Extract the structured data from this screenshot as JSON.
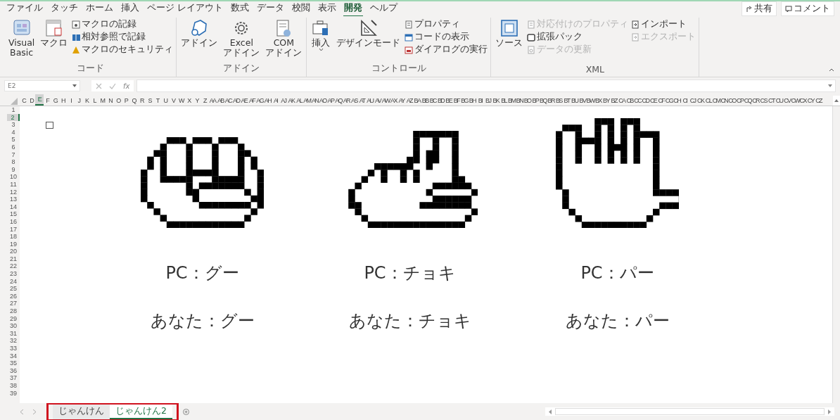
{
  "ribbon_tabs": [
    {
      "label": "ファイル",
      "selected": false
    },
    {
      "label": "タッチ",
      "selected": false
    },
    {
      "label": "ホーム",
      "selected": false
    },
    {
      "label": "挿入",
      "selected": false
    },
    {
      "label": "ページ レイアウト",
      "selected": false
    },
    {
      "label": "数式",
      "selected": false
    },
    {
      "label": "データ",
      "selected": false
    },
    {
      "label": "校閲",
      "selected": false
    },
    {
      "label": "表示",
      "selected": false
    },
    {
      "label": "開発",
      "selected": true
    },
    {
      "label": "ヘルプ",
      "selected": false
    }
  ],
  "header_buttons": [
    {
      "label": "共有",
      "kind": "share"
    },
    {
      "label": "コメント",
      "kind": "comment"
    }
  ],
  "ribbon_groups": [
    {
      "name": "コード",
      "items": [
        {
          "kind": "large",
          "label": "Visual Basic"
        },
        {
          "kind": "large",
          "label": "マクロ"
        },
        {
          "kind": "stack",
          "items": [
            {
              "label": "マクロの記録",
              "disabled": false
            },
            {
              "label": "相対参照で記録",
              "disabled": false
            },
            {
              "label": "マクロのセキュリティ",
              "disabled": false
            }
          ]
        }
      ]
    },
    {
      "name": "アドイン",
      "items": [
        {
          "kind": "large",
          "label": "アドイン"
        },
        {
          "kind": "large",
          "label": "Excel アドイン"
        },
        {
          "kind": "large",
          "label": "COM アドイン"
        }
      ]
    },
    {
      "name": "コントロール",
      "items": [
        {
          "kind": "dropdown",
          "label": "挿入"
        },
        {
          "kind": "large",
          "label": "デザインモード"
        },
        {
          "kind": "stack",
          "items": [
            {
              "label": "プロパティ",
              "disabled": false
            },
            {
              "label": "コードの表示",
              "disabled": false
            },
            {
              "label": "ダイアログの実行",
              "disabled": false
            }
          ]
        }
      ]
    },
    {
      "name": "XML",
      "items": [
        {
          "kind": "large",
          "label": "ソース"
        },
        {
          "kind": "stack",
          "items": [
            {
              "label": "対応付けのプロパティ",
              "disabled": true
            },
            {
              "label": "拡張パック",
              "disabled": false
            },
            {
              "label": "データの更新",
              "disabled": true
            }
          ]
        },
        {
          "kind": "stack",
          "items": [
            {
              "label": "インポート",
              "disabled": false
            },
            {
              "label": "エクスポート",
              "disabled": true
            }
          ]
        }
      ]
    }
  ],
  "formula_bar": {
    "name_box": "E2",
    "function_label": "fx"
  },
  "columns": [
    {
      "label": "C",
      "selected": false
    },
    {
      "label": "D",
      "selected": false
    },
    {
      "label": "E",
      "selected": true
    },
    {
      "label": "F",
      "selected": false
    },
    {
      "label": "G",
      "selected": false
    },
    {
      "label": "H",
      "selected": false
    },
    {
      "label": "I",
      "selected": false
    },
    {
      "label": "J",
      "selected": false
    },
    {
      "label": "K",
      "selected": false
    },
    {
      "label": "L",
      "selected": false
    },
    {
      "label": "M",
      "selected": false
    },
    {
      "label": "N",
      "selected": false
    },
    {
      "label": "O",
      "selected": false
    },
    {
      "label": "P",
      "selected": false
    },
    {
      "label": "Q",
      "selected": false
    },
    {
      "label": "R",
      "selected": false
    },
    {
      "label": "S",
      "selected": false
    },
    {
      "label": "T",
      "selected": false
    },
    {
      "label": "U",
      "selected": false
    },
    {
      "label": "V",
      "selected": false
    },
    {
      "label": "W",
      "selected": false
    },
    {
      "label": "X",
      "selected": false
    },
    {
      "label": "Y",
      "selected": false
    },
    {
      "label": "Z",
      "selected": false
    },
    {
      "label": "AA",
      "selected": false
    },
    {
      "label": "AB",
      "selected": false
    },
    {
      "label": "AC",
      "selected": false
    },
    {
      "label": "AD",
      "selected": false
    },
    {
      "label": "AE",
      "selected": false
    },
    {
      "label": "AF",
      "selected": false
    },
    {
      "label": "AG",
      "selected": false
    },
    {
      "label": "AH",
      "selected": false
    },
    {
      "label": "AI",
      "selected": false
    },
    {
      "label": "AJ",
      "selected": false
    },
    {
      "label": "AK",
      "selected": false
    },
    {
      "label": "AL",
      "selected": false
    },
    {
      "label": "AM",
      "selected": false
    },
    {
      "label": "AN",
      "selected": false
    },
    {
      "label": "AO",
      "selected": false
    },
    {
      "label": "AP",
      "selected": false
    },
    {
      "label": "AQ",
      "selected": false
    },
    {
      "label": "AR",
      "selected": false
    },
    {
      "label": "AS",
      "selected": false
    },
    {
      "label": "AT",
      "selected": false
    },
    {
      "label": "AU",
      "selected": false
    },
    {
      "label": "AV",
      "selected": false
    },
    {
      "label": "AW",
      "selected": false
    },
    {
      "label": "AX",
      "selected": false
    },
    {
      "label": "AY",
      "selected": false
    },
    {
      "label": "AZ",
      "selected": false
    },
    {
      "label": "BA",
      "selected": false
    },
    {
      "label": "BB",
      "selected": false
    },
    {
      "label": "BC",
      "selected": false
    },
    {
      "label": "BD",
      "selected": false
    },
    {
      "label": "BE",
      "selected": false
    },
    {
      "label": "BF",
      "selected": false
    },
    {
      "label": "BG",
      "selected": false
    },
    {
      "label": "BH",
      "selected": false
    },
    {
      "label": "BI",
      "selected": false
    },
    {
      "label": "BJ",
      "selected": false
    },
    {
      "label": "BK",
      "selected": false
    },
    {
      "label": "BL",
      "selected": false
    },
    {
      "label": "BM",
      "selected": false
    },
    {
      "label": "BN",
      "selected": false
    },
    {
      "label": "BO",
      "selected": false
    },
    {
      "label": "BP",
      "selected": false
    },
    {
      "label": "BQ",
      "selected": false
    },
    {
      "label": "BR",
      "selected": false
    },
    {
      "label": "BS",
      "selected": false
    },
    {
      "label": "BT",
      "selected": false
    },
    {
      "label": "BU",
      "selected": false
    },
    {
      "label": "BV",
      "selected": false
    },
    {
      "label": "BW",
      "selected": false
    },
    {
      "label": "BX",
      "selected": false
    },
    {
      "label": "BY",
      "selected": false
    },
    {
      "label": "BZ",
      "selected": false
    },
    {
      "label": "CA",
      "selected": false
    },
    {
      "label": "CB",
      "selected": false
    },
    {
      "label": "CC",
      "selected": false
    },
    {
      "label": "CD",
      "selected": false
    },
    {
      "label": "CE",
      "selected": false
    },
    {
      "label": "CF",
      "selected": false
    },
    {
      "label": "CG",
      "selected": false
    },
    {
      "label": "CH",
      "selected": false
    },
    {
      "label": "CI",
      "selected": false
    },
    {
      "label": "CJ",
      "selected": false
    },
    {
      "label": "CK",
      "selected": false
    },
    {
      "label": "CL",
      "selected": false
    },
    {
      "label": "CM",
      "selected": false
    },
    {
      "label": "CN",
      "selected": false
    },
    {
      "label": "CO",
      "selected": false
    },
    {
      "label": "CP",
      "selected": false
    },
    {
      "label": "CQ",
      "selected": false
    },
    {
      "label": "CR",
      "selected": false
    },
    {
      "label": "CS",
      "selected": false
    },
    {
      "label": "CT",
      "selected": false
    },
    {
      "label": "CU",
      "selected": false
    },
    {
      "label": "CV",
      "selected": false
    },
    {
      "label": "CW",
      "selected": false
    },
    {
      "label": "CX",
      "selected": false
    },
    {
      "label": "CY",
      "selected": false
    },
    {
      "label": "CZ",
      "selected": false
    }
  ],
  "rows": [
    {
      "label": "1",
      "selected": false
    },
    {
      "label": "2",
      "selected": true
    },
    {
      "label": "3",
      "selected": false
    },
    {
      "label": "4",
      "selected": false
    },
    {
      "label": "5",
      "selected": false
    },
    {
      "label": "6",
      "selected": false
    },
    {
      "label": "7",
      "selected": false
    },
    {
      "label": "8",
      "selected": false
    },
    {
      "label": "9",
      "selected": false
    },
    {
      "label": "10",
      "selected": false
    },
    {
      "label": "11",
      "selected": false
    },
    {
      "label": "12",
      "selected": false
    },
    {
      "label": "13",
      "selected": false
    },
    {
      "label": "14",
      "selected": false
    },
    {
      "label": "15",
      "selected": false
    },
    {
      "label": "16",
      "selected": false
    },
    {
      "label": "17",
      "selected": false
    },
    {
      "label": "18",
      "selected": false
    },
    {
      "label": "19",
      "selected": false
    },
    {
      "label": "20",
      "selected": false
    },
    {
      "label": "21",
      "selected": false
    },
    {
      "label": "22",
      "selected": false
    },
    {
      "label": "23",
      "selected": false
    },
    {
      "label": "24",
      "selected": false
    },
    {
      "label": "25",
      "selected": false
    },
    {
      "label": "26",
      "selected": false
    },
    {
      "label": "27",
      "selected": false
    },
    {
      "label": "28",
      "selected": false
    },
    {
      "label": "29",
      "selected": false
    },
    {
      "label": "30",
      "selected": false
    },
    {
      "label": "31",
      "selected": false
    },
    {
      "label": "32",
      "selected": false
    },
    {
      "label": "33",
      "selected": false
    },
    {
      "label": "34",
      "selected": false
    },
    {
      "label": "35",
      "selected": false
    },
    {
      "label": "36",
      "selected": false
    },
    {
      "label": "37",
      "selected": false
    },
    {
      "label": "38",
      "selected": false
    },
    {
      "label": "39",
      "selected": false
    }
  ],
  "hands": [
    {
      "kind": "rock",
      "pc": "PC：グー",
      "you": "あなた：グー"
    },
    {
      "kind": "scissors",
      "pc": "PC：チョキ",
      "you": "あなた：チョキ"
    },
    {
      "kind": "paper",
      "pc": "PC：パー",
      "you": "あなた：パー"
    }
  ],
  "sheet_tabs": [
    {
      "label": "じゃんけん",
      "selected": false
    },
    {
      "label": "じゃんけん2",
      "selected": true
    }
  ],
  "sheet_tabs_highlighted": true
}
